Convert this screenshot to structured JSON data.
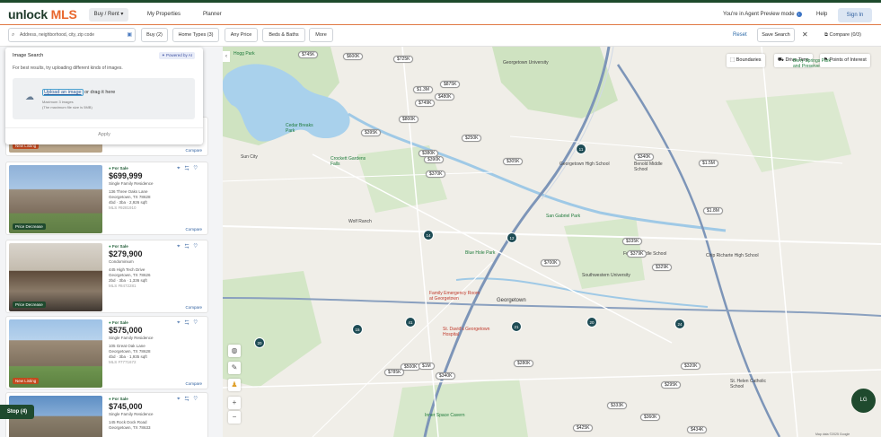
{
  "header": {
    "logo_unlock": "unlock",
    "logo_mls": "MLS",
    "buy_rent": "Buy / Rent",
    "my_properties": "My Properties",
    "planner": "Planner",
    "agent_mode": "You're in Agent Preview mode",
    "help": "Help",
    "sign_in": "Sign In"
  },
  "filters": {
    "search_placeholder": "Address, neighborhood, city, zip code",
    "buy": "Buy (2)",
    "home_types": "Home Types (3)",
    "any_price": "Any Price",
    "beds_baths": "Beds & Baths",
    "more": "More",
    "reset": "Reset",
    "save_search": "Save Search",
    "compare": "Compare (0/3)"
  },
  "image_search": {
    "title": "Image Search",
    "powered": "Powered by AI",
    "hint": "For best results, try uploading different kinds of images.",
    "upload_link": "Upload an image",
    "upload_rest": " or drag it here",
    "max": "Maximum 3 images",
    "size": "(The maximum file size is 5MB)",
    "apply": "Apply"
  },
  "listings": [
    {
      "status": "For Sale",
      "price": "$699,999",
      "type": "Single Family Residence",
      "address": "136 Three Oaks Lane",
      "city": "Georgetown, TX 78628",
      "specs": "4bd · 3ba · 2,926 sqft",
      "mls": "MLS #9281910",
      "badge": "Price Decrease",
      "compare": "Compare"
    },
    {
      "status": "For Sale",
      "price": "$279,900",
      "type": "Condominium",
      "address": "445 High Tech Drive",
      "city": "Georgetown, TX 78626",
      "specs": "2bd · 3ba · 1,336 sqft",
      "mls": "MLS #8472281",
      "badge": "Price Decrease",
      "compare": "Compare"
    },
    {
      "status": "For Sale",
      "price": "$575,000",
      "type": "Single Family Residence",
      "address": "105 Great Oak Lane",
      "city": "Georgetown, TX 78628",
      "specs": "4bd · 3ba · 1,935 sqft",
      "mls": "MLS #7771672",
      "badge": "New Listing",
      "compare": "Compare"
    },
    {
      "status": "For Sale",
      "price": "$745,000",
      "type": "Single Family Residence",
      "address": "145 Rock Dock Road",
      "city": "Georgetown, TX 78633",
      "specs": "",
      "mls": "",
      "badge": "",
      "compare": ""
    }
  ],
  "partial_card": {
    "badge": "New Listing",
    "compare": "Compare"
  },
  "stop_button": "Stop (4)",
  "avatar": "LG",
  "map": {
    "boundaries": "Boundaries",
    "drive_time": "Drive Time",
    "poi": "Points of Interest",
    "labels": {
      "georgetown": "Georgetown",
      "georgetown_hs": "Georgetown High School",
      "san_gabriel": "San Gabriel Park",
      "blue_hole": "Blue Hole Park",
      "er": "Family Emergency Room at Georgetown",
      "st_davids": "St. David's Georgetown Hospital",
      "inner_space": "Inner Space Cavern",
      "southwestern": "Southwestern University",
      "berry_springs": "Berry Springs Park and Preserve",
      "georgetown_uni": "Georgetown University",
      "crockett": "Crockett Gardens Falls",
      "chip_richarte": "Chip Richarte High School",
      "benold": "Benold Middle School",
      "forbes": "Forbes Middle School",
      "cedar_breaks": "Cedar Breaks Park",
      "wolf_ranch": "Wolf Ranch",
      "sun_city": "Sun City",
      "st_helen": "St. Helen Catholic School",
      "hogg_park": "Hogg Park"
    },
    "price_pins": [
      "$745K",
      "$600K",
      "$725K",
      "$875K",
      "$1.3M",
      "$480K",
      "$749K",
      "$800K",
      "$395K",
      "$250K",
      "$380K",
      "$390K",
      "$305K",
      "$370K",
      "$340K",
      "$1.5M",
      "$1.8M",
      "$335K",
      "$379K",
      "$700K",
      "$329K",
      "$280K",
      "$500K",
      "$340K",
      "$320K",
      "$295K",
      "$333K",
      "$360K",
      "$425K",
      "$434K",
      "$1M",
      "$785K"
    ],
    "clusters": [
      "11",
      "14",
      "12",
      "15",
      "41",
      "21",
      "20",
      "24",
      "20"
    ],
    "footer": "Map data ©2025 Google"
  }
}
